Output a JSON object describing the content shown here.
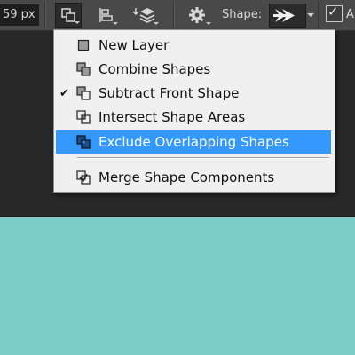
{
  "toolbar": {
    "size_value": "59 px",
    "shape_label": "Shape:",
    "align_checkbox_checked": true,
    "trailing_label": "A"
  },
  "menu": {
    "items": [
      {
        "label": "New Layer",
        "checked": false,
        "highlighted": false,
        "icon": "new-layer-icon"
      },
      {
        "label": "Combine Shapes",
        "checked": false,
        "highlighted": false,
        "icon": "combine-shapes-icon"
      },
      {
        "label": "Subtract Front Shape",
        "checked": true,
        "highlighted": false,
        "icon": "subtract-front-shape-icon"
      },
      {
        "label": "Intersect Shape Areas",
        "checked": false,
        "highlighted": false,
        "icon": "intersect-shape-areas-icon"
      },
      {
        "label": "Exclude Overlapping Shapes",
        "checked": false,
        "highlighted": true,
        "icon": "exclude-overlapping-shapes-icon"
      },
      {
        "label": "Merge Shape Components",
        "checked": false,
        "highlighted": false,
        "icon": "merge-shape-components-icon"
      }
    ]
  },
  "colors": {
    "toolbar_bg": "#494949",
    "workspace_bg": "#282828",
    "canvas_bg": "#7ccdc6",
    "menu_bg": "#f0f0f0",
    "highlight": "#3399ff"
  }
}
